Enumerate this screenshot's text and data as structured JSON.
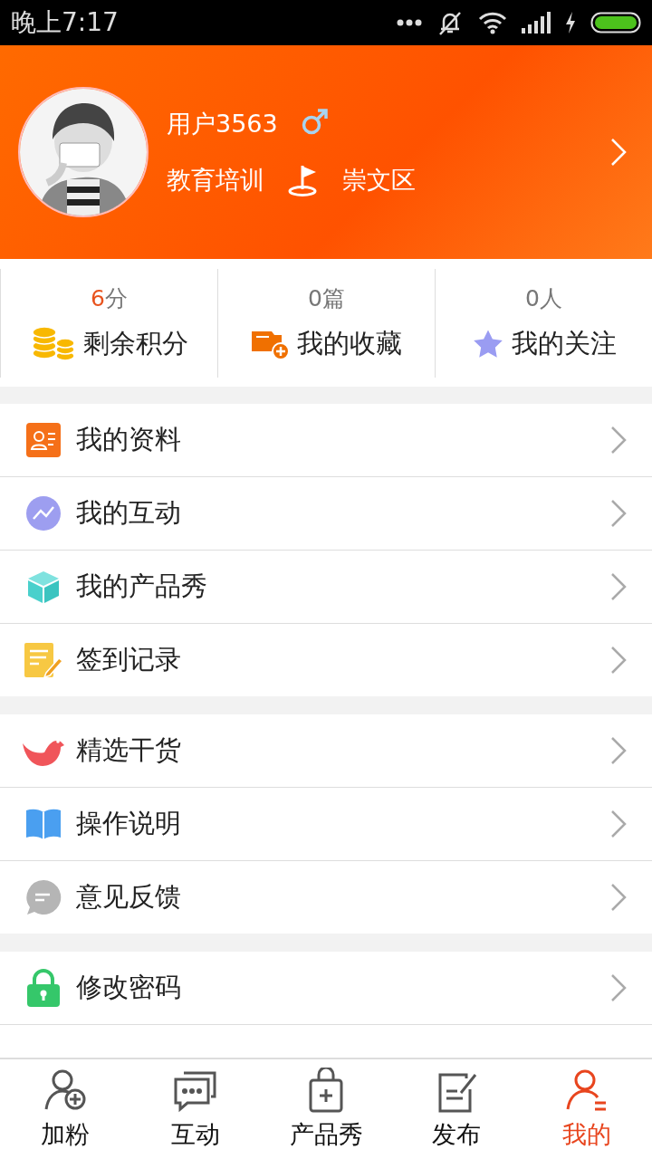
{
  "status_bar": {
    "time": "晚上7:17"
  },
  "profile": {
    "name": "用户3563",
    "industry": "教育培训",
    "district": "崇文区"
  },
  "stats": [
    {
      "count": "6",
      "unit": "分",
      "highlight": true,
      "label": "剩余积分"
    },
    {
      "count": "0",
      "unit": "篇",
      "highlight": false,
      "label": "我的收藏"
    },
    {
      "count": "0",
      "unit": "人",
      "highlight": false,
      "label": "我的关注"
    }
  ],
  "menu_groups": [
    [
      {
        "label": "我的资料"
      },
      {
        "label": "我的互动"
      },
      {
        "label": "我的产品秀"
      },
      {
        "label": "签到记录"
      }
    ],
    [
      {
        "label": "精选干货"
      },
      {
        "label": "操作说明"
      },
      {
        "label": "意见反馈"
      }
    ],
    [
      {
        "label": "修改密码"
      }
    ]
  ],
  "bottom_nav": [
    {
      "label": "加粉",
      "selected": false
    },
    {
      "label": "互动",
      "selected": false
    },
    {
      "label": "产品秀",
      "selected": false
    },
    {
      "label": "发布",
      "selected": false
    },
    {
      "label": "我的",
      "selected": true
    }
  ]
}
